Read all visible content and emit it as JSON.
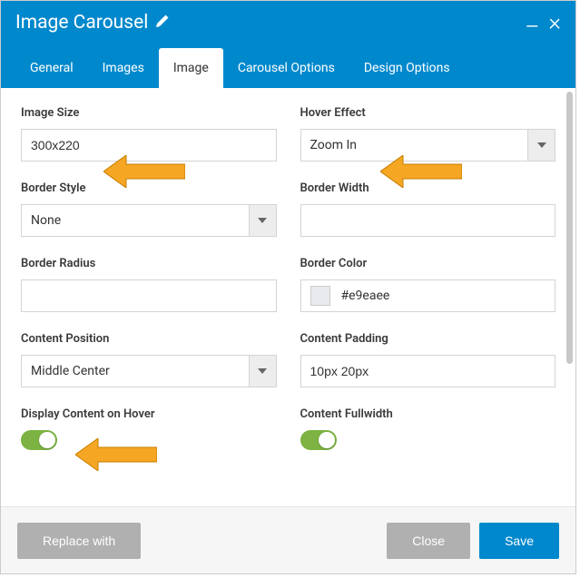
{
  "header": {
    "title": "Image Carousel"
  },
  "tabs": [
    {
      "label": "General"
    },
    {
      "label": "Images"
    },
    {
      "label": "Image"
    },
    {
      "label": "Carousel Options"
    },
    {
      "label": "Design Options"
    }
  ],
  "activeTab": 2,
  "fields": {
    "imageSize": {
      "label": "Image Size",
      "value": "300x220"
    },
    "hoverEffect": {
      "label": "Hover Effect",
      "value": "Zoom In"
    },
    "borderStyle": {
      "label": "Border Style",
      "value": "None"
    },
    "borderWidth": {
      "label": "Border Width",
      "value": ""
    },
    "borderRadius": {
      "label": "Border Radius",
      "value": ""
    },
    "borderColor": {
      "label": "Border Color",
      "value": "#e9eaee"
    },
    "contentPosition": {
      "label": "Content Position",
      "value": "Middle Center"
    },
    "contentPadding": {
      "label": "Content Padding",
      "value": "10px 20px"
    },
    "displayContentOnHover": {
      "label": "Display Content on Hover",
      "on": true
    },
    "contentFullwidth": {
      "label": "Content Fullwidth",
      "on": true
    }
  },
  "footer": {
    "replaceWith": "Replace with",
    "close": "Close",
    "save": "Save"
  },
  "colors": {
    "brand": "#0088cc",
    "toggleOn": "#7cb342",
    "arrow": "#f5a623"
  }
}
